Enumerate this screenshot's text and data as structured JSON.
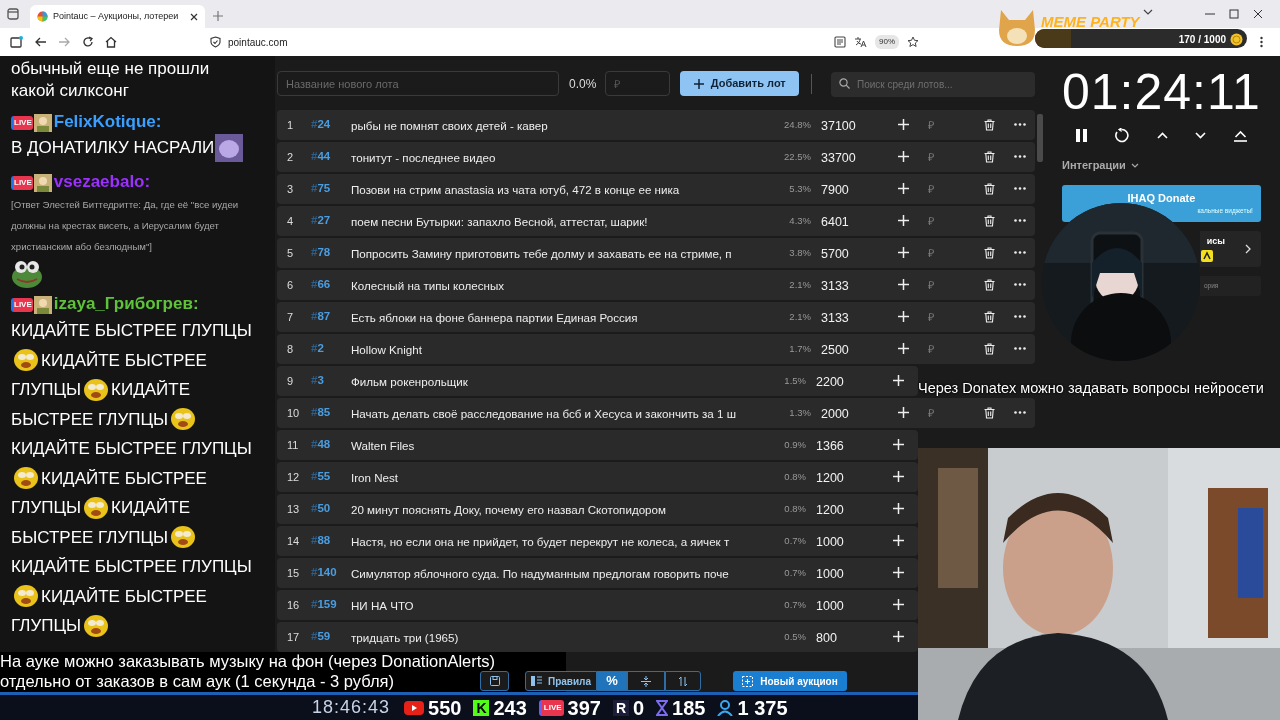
{
  "browser": {
    "tab_title": "Pointauc – Аукционы, лотереи",
    "url": "pointauc.com",
    "zoom": "90%"
  },
  "meme_party": {
    "title": "MEME PARTY",
    "progress": "170 / 1000",
    "level": 0.17
  },
  "chat": {
    "messages": [
      {
        "kind": "text",
        "text": "обычный еще не прошли какой силксонг"
      },
      {
        "kind": "message",
        "badge": "LIVE",
        "name": "FelixKotique:",
        "color": "#3aa0ff",
        "text": "В ДОНАТИЛКУ НАСРАЛИ",
        "emote": true
      },
      {
        "kind": "reply",
        "badge": "LIVE",
        "name": "vsezaebalo:",
        "color": "#9b30ff",
        "text": "[Ответ Элестей Биттедритте: Да, где её \"все иудеи должны на крестах висеть, а Иерусалим будет христианским або безлюдным\"]",
        "emote": true
      },
      {
        "kind": "lines",
        "badge": "LIVE",
        "name": "izaya_Грибогрев:",
        "color": "#5fc23a",
        "lines": [
          [
            {
              "kind": "text",
              "text": "КИДАЙТЕ БЫСТРЕЕ ГЛУПЦЫ"
            }
          ],
          [
            {
              "kind": "emote"
            },
            {
              "kind": "text",
              "text": "КИДАЙТЕ БЫСТРЕЕ"
            }
          ],
          [
            {
              "kind": "text",
              "text": "ГЛУПЦЫ"
            },
            {
              "kind": "emote"
            },
            {
              "kind": "text",
              "text": "КИДАЙТЕ"
            }
          ],
          [
            {
              "kind": "text",
              "text": "БЫСТРЕЕ ГЛУПЦЫ"
            },
            {
              "kind": "emote"
            }
          ],
          [
            {
              "kind": "text",
              "text": "КИДАЙТЕ БЫСТРЕЕ ГЛУПЦЫ"
            }
          ],
          [
            {
              "kind": "emote"
            },
            {
              "kind": "text",
              "text": "КИДАЙТЕ БЫСТРЕЕ"
            }
          ],
          [
            {
              "kind": "text",
              "text": "ГЛУПЦЫ"
            },
            {
              "kind": "emote"
            },
            {
              "kind": "text",
              "text": "КИДАЙТЕ"
            }
          ],
          [
            {
              "kind": "text",
              "text": "БЫСТРЕЕ ГЛУПЦЫ"
            },
            {
              "kind": "emote"
            }
          ],
          [
            {
              "kind": "text",
              "text": "КИДАЙТЕ БЫСТРЕЕ ГЛУПЦЫ"
            }
          ],
          [
            {
              "kind": "emote"
            },
            {
              "kind": "text",
              "text": "КИДАЙТЕ БЫСТРЕЕ"
            }
          ],
          [
            {
              "kind": "text",
              "text": "ГЛУПЦЫ"
            },
            {
              "kind": "emote"
            }
          ]
        ]
      }
    ]
  },
  "auction": {
    "new_lot": {
      "placeholder": "Название нового лота"
    },
    "percent": "0.0%",
    "amount": {
      "placeholder": "₽"
    },
    "add_button": "Добавить лот",
    "search": {
      "placeholder": "Поиск среди лотов..."
    },
    "lots": [
      {
        "rank": "1",
        "id": "#24",
        "name": "рыбы не помнят своих детей - кавер",
        "percent": "24.8%",
        "amount": "37100",
        "currency": "₽"
      },
      {
        "rank": "2",
        "id": "#44",
        "name": "тонитут - последнее видео",
        "percent": "22.5%",
        "amount": "33700",
        "currency": "₽"
      },
      {
        "rank": "3",
        "id": "#75",
        "name": "Позови на стрим anastasia из чата ютуб, 472 в конце ее ника",
        "percent": "5.3%",
        "amount": "7900",
        "currency": "₽"
      },
      {
        "rank": "4",
        "id": "#27",
        "name": "поем песни Бутырки: запахло Весной, аттестат, шарик!",
        "percent": "4.3%",
        "amount": "6401",
        "currency": "₽"
      },
      {
        "rank": "5",
        "id": "#78",
        "name": "Попросить Замину приготовить тебе долму и захавать ее на стриме, п",
        "percent": "3.8%",
        "amount": "5700",
        "currency": "₽"
      },
      {
        "rank": "6",
        "id": "#66",
        "name": "Колесный на типы колесных",
        "percent": "2.1%",
        "amount": "3133",
        "currency": "₽"
      },
      {
        "rank": "7",
        "id": "#87",
        "name": "Есть яблоки на фоне баннера партии Единая Россия",
        "percent": "2.1%",
        "amount": "3133",
        "currency": "₽"
      },
      {
        "rank": "8",
        "id": "#2",
        "name": "Hollow Knight",
        "percent": "1.7%",
        "amount": "2500",
        "currency": "₽"
      },
      {
        "rank": "9",
        "id": "#3",
        "name": "Фильм рокенрольщик",
        "percent": "1.5%",
        "amount": "2200"
      },
      {
        "rank": "10",
        "id": "#85",
        "name": "Начать делать своё расследование на бсб и Хесуса и закончить за 1 ш",
        "percent": "1.3%",
        "amount": "2000",
        "currency": "₽"
      },
      {
        "rank": "11",
        "id": "#48",
        "name": "Walten Files",
        "percent": "0.9%",
        "amount": "1366"
      },
      {
        "rank": "12",
        "id": "#55",
        "name": "Iron Nest",
        "percent": "0.8%",
        "amount": "1200"
      },
      {
        "rank": "13",
        "id": "#50",
        "name": "20 минут пояснять Доку, почему его назвал Скотопидором",
        "percent": "0.8%",
        "amount": "1200"
      },
      {
        "rank": "14",
        "id": "#88",
        "name": "Настя, но если она не прийдет, то будет перекрут не колеса, а яичек т",
        "percent": "0.7%",
        "amount": "1000"
      },
      {
        "rank": "15",
        "id": "#140",
        "name": "Симулятор яблочного суда. По надуманным предлогам говорить поче",
        "percent": "0.7%",
        "amount": "1000"
      },
      {
        "rank": "16",
        "id": "#159",
        "name": "НИ НА ЧТО",
        "percent": "0.7%",
        "amount": "1000"
      },
      {
        "rank": "17",
        "id": "#59",
        "name": "тридцать три (1965)",
        "percent": "0.5%",
        "amount": "800"
      }
    ]
  },
  "timer": {
    "time": "01:24:11",
    "integrations_label": "Интеграции",
    "cards": [
      {
        "title": "IHAQ Donate",
        "subtitle": "кальные виджеты!"
      },
      {
        "title": "исы"
      },
      {
        "title": "ория"
      }
    ]
  },
  "toolbar": {
    "buttons": [
      {
        "kind": "save",
        "selected": false
      },
      {
        "kind": "rules",
        "label": "Правила",
        "selected": false
      },
      {
        "kind": "percent",
        "label": "%",
        "selected": true
      },
      {
        "kind": "compress",
        "selected": false
      },
      {
        "kind": "sort",
        "selected": false
      }
    ],
    "new_auction_button": "Новый аукцион"
  },
  "overlay_text": "Через Donatex можно задавать вопросы нейросети",
  "subtitles": [
    "На ауке можно заказывать музыку на фон (через DonationAlerts)",
    "отдельно от заказов в сам аук (1 секунда - 3 рубля)"
  ],
  "status_bar": {
    "time": "18:46:43",
    "stats": [
      {
        "kind": "youtube",
        "count": "550"
      },
      {
        "kind": "kick",
        "badge": "K",
        "count": "243"
      },
      {
        "kind": "live",
        "badge": "LIVE",
        "count": "397"
      },
      {
        "kind": "r",
        "badge": "R",
        "count": "0"
      },
      {
        "kind": "hourglass",
        "count": "185"
      },
      {
        "kind": "viewers",
        "count": "1 375"
      }
    ]
  }
}
